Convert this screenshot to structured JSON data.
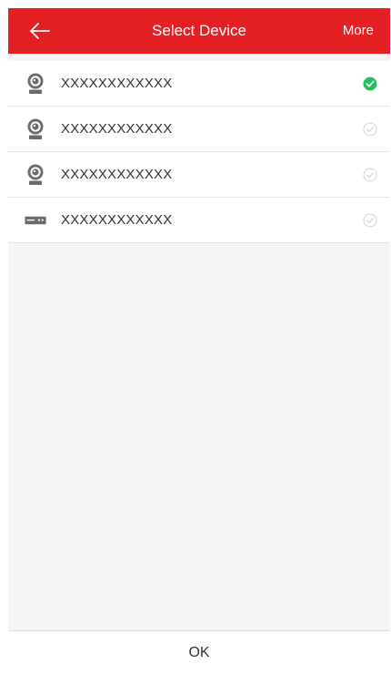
{
  "header": {
    "title": "Select Device",
    "more_label": "More",
    "back_icon": "arrow-left-icon"
  },
  "devices": [
    {
      "name": "XXXXXXXXXXXX",
      "icon": "camera-icon",
      "selected": true
    },
    {
      "name": "XXXXXXXXXXXX",
      "icon": "camera-icon",
      "selected": false
    },
    {
      "name": "XXXXXXXXXXXX",
      "icon": "camera-icon",
      "selected": false
    },
    {
      "name": "XXXXXXXXXXXX",
      "icon": "nvr-recorder-icon",
      "selected": false
    }
  ],
  "footer": {
    "ok_label": "OK"
  },
  "colors": {
    "brand": "#e52024",
    "selected_check": "#22c35e",
    "unselected_check": "#cfcfcf"
  }
}
